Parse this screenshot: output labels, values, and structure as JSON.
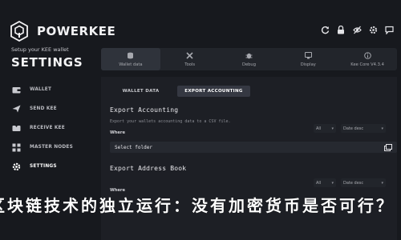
{
  "app": {
    "brand": "POWERKEE",
    "setup_line": "Setup your KEE wallet",
    "page_title": "SETTINGS"
  },
  "sidebar": {
    "items": [
      {
        "label": "WALLET",
        "icon": "wallet-icon"
      },
      {
        "label": "SEND KEE",
        "icon": "send-icon"
      },
      {
        "label": "RECEIVE KEE",
        "icon": "receive-icon"
      },
      {
        "label": "MASTER NODES",
        "icon": "masternodes-icon"
      },
      {
        "label": "SETTINGS",
        "icon": "settings-icon",
        "active": true
      }
    ]
  },
  "header_icons": [
    "refresh-icon",
    "lock-icon",
    "visibility-icon",
    "gear-icon",
    "chat-icon"
  ],
  "topnav": {
    "items": [
      {
        "label": "Wallet data",
        "icon": "database-icon",
        "active": true
      },
      {
        "label": "Tools",
        "icon": "tools-icon"
      },
      {
        "label": "Debug",
        "icon": "debug-icon"
      },
      {
        "label": "Display",
        "icon": "display-icon"
      },
      {
        "label": "Kee Core V4.3.4",
        "icon": "info-icon"
      }
    ]
  },
  "subtabs": {
    "items": [
      {
        "label": "WALLET DATA",
        "active": false
      },
      {
        "label": "EXPORT ACCOUNTING",
        "active": true
      }
    ]
  },
  "export_accounting": {
    "title": "Export Accounting",
    "description": "Export your wallets accounting data to a CSV file.",
    "where_label": "Where",
    "filter_all": "All",
    "filter_date": "Date desc",
    "select_folder": "Select folder"
  },
  "export_address_book": {
    "title": "Export Address Book",
    "where_label": "Where",
    "filter_all": "All",
    "filter_date": "Date desc"
  },
  "overlay_text": "区块链技术的独立运行：没有加密货币是否可行？",
  "colors": {
    "background": "#17191e",
    "panel": "#1d1f25",
    "tab_active": "#2f333b"
  }
}
